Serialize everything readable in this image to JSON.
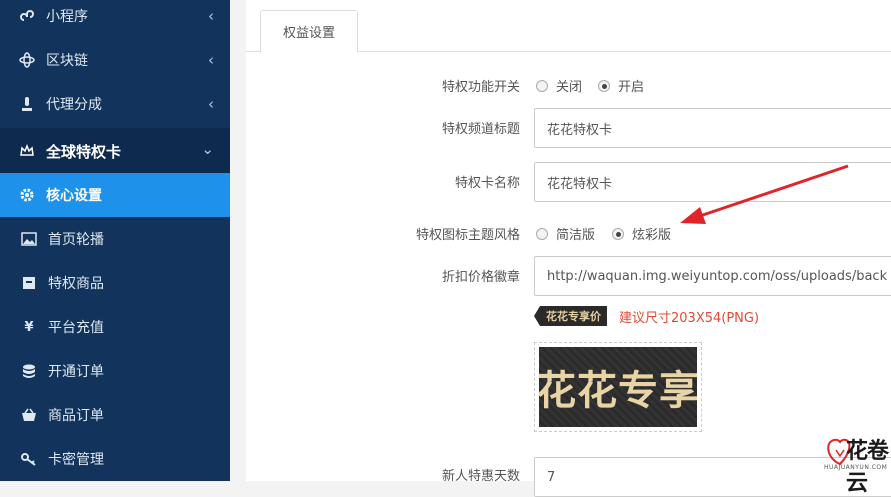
{
  "sidebar": {
    "items": [
      {
        "icon": "mini-program-icon",
        "label": "小程序",
        "chevron": "‹"
      },
      {
        "icon": "blockchain-icon",
        "label": "区块链",
        "chevron": "‹"
      },
      {
        "icon": "agent-icon",
        "label": "代理分成",
        "chevron": "‹"
      },
      {
        "icon": "crown-icon",
        "label": "全球特权卡",
        "chevron": "⌄"
      },
      {
        "icon": "gear-icon",
        "label": "核心设置"
      },
      {
        "icon": "image-icon",
        "label": "首页轮播"
      },
      {
        "icon": "box-icon",
        "label": "特权商品"
      },
      {
        "icon": "yen-icon",
        "label": "平台充值"
      },
      {
        "icon": "database-icon",
        "label": "开通订单"
      },
      {
        "icon": "basket-icon",
        "label": "商品订单"
      },
      {
        "icon": "key-icon",
        "label": "卡密管理"
      }
    ]
  },
  "tab": {
    "label": "权益设置"
  },
  "form": {
    "switch": {
      "label": "特权功能开关",
      "options": [
        "关闭",
        "开启"
      ],
      "selected": "开启"
    },
    "channel_title": {
      "label": "特权频道标题",
      "value": "花花特权卡"
    },
    "card_name": {
      "label": "特权卡名称",
      "value": "花花特权卡"
    },
    "icon_style": {
      "label": "特权图标主题风格",
      "options": [
        "简洁版",
        "炫彩版"
      ],
      "selected": "炫彩版"
    },
    "discount_badge": {
      "label": "折扣价格徽章",
      "value": "http://waquan.img.weiyuntop.com/oss/uploads/back",
      "badge_text": "花花专享价",
      "hint": "建议尺寸203X54(PNG)",
      "preview_text": "花花专享"
    },
    "new_user_days": {
      "label": "新人特惠天数",
      "value": "7"
    }
  },
  "watermark": {
    "text": "花卷云",
    "sub": "HUAJUANYUN.COM"
  },
  "colors": {
    "sidebar_bg": "#12345c",
    "active_bg": "#1e92ea",
    "hint": "#e24a35",
    "arrow": "#e0242a"
  }
}
